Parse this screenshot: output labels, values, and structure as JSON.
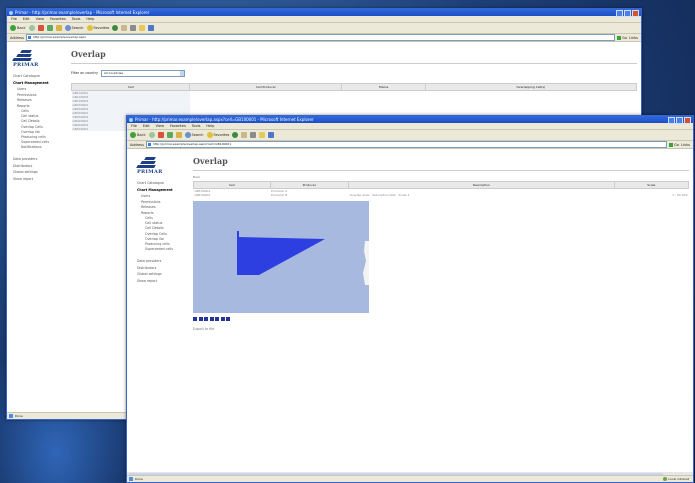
{
  "colors": {
    "desktop": "#1d3f78",
    "titlebar": "#1d4fc4",
    "map_background": "#a7b9df",
    "map_polygon": "#2d3fe0",
    "brand": "#1e3f85"
  },
  "back_window": {
    "title": "Primar - http://primar.example/overlap - Microsoft Internet Explorer",
    "menu": [
      "File",
      "Edit",
      "View",
      "Favorites",
      "Tools",
      "Help"
    ],
    "toolbar": {
      "back": "Back",
      "search": "Search",
      "favorites": "Favorites"
    },
    "address": {
      "label": "Address",
      "url": "http://primar.example/overlap.aspx",
      "go": "Go",
      "links": "Links"
    },
    "logo": "PRIMAR",
    "sidebar": {
      "items": [
        "Chart Catalogue",
        "Chart Management"
      ],
      "sub": [
        "Users",
        "Permissions",
        "Releases",
        "Reports"
      ],
      "sub2": [
        "Cells",
        "Cell status",
        "Cell Details",
        "Overlap Cells",
        "Overlap list",
        "Producing cells",
        "Superseded cells",
        "Notifications"
      ],
      "bottom": [
        "Data providers",
        "Distributors",
        "Global settings",
        "Show report"
      ]
    },
    "page_title": "Overlap",
    "filter_label": "Filter on country",
    "filter_value": "All Countries",
    "table_headers": [
      "Cell",
      "Cell Producer",
      "Status",
      "Overlapping Cell(s)"
    ],
    "rows": [
      "GB100001",
      "GB100002",
      "GB100003",
      "GB200001",
      "GB200002",
      "GB300001",
      "GB300002",
      "GB400001",
      "GB400002",
      "GB500001"
    ],
    "status": "Done",
    "zone": "Local intranet"
  },
  "front_window": {
    "title": "Primar - http://primar.example/overlap.aspx?cell=GB100001 - Microsoft Internet Explorer",
    "menu": [
      "File",
      "Edit",
      "View",
      "Favorites",
      "Tools",
      "Help"
    ],
    "toolbar": {
      "back": "Back",
      "search": "Search",
      "favorites": "Favorites"
    },
    "address": {
      "label": "Address",
      "url": "http://primar.example/overlap.aspx?cell=GB100001",
      "go": "Go",
      "links": "Links"
    },
    "logo": "PRIMAR",
    "sidebar": {
      "items": [
        "Chart Catalogue",
        "Chart Management"
      ],
      "sub": [
        "Users",
        "Permissions",
        "Releases",
        "Reports"
      ],
      "sub2": [
        "Cells",
        "Cell status",
        "Cell Details",
        "Overlap Cells",
        "Overlap list",
        "Producing cells",
        "Superseded cells"
      ],
      "bottom": [
        "Data providers",
        "Distributors",
        "Global settings",
        "Show report"
      ]
    },
    "page_title": "Overlap",
    "back_link": "Back",
    "table_headers": [
      "Cell",
      "Producer",
      "Description",
      "Scale"
    ],
    "rows": [
      [
        "GB100001",
        "Producer A",
        "",
        ""
      ],
      [
        "GB100002",
        "Producer B",
        "Overlap area - description text - Scale 1",
        "1 : 50 000"
      ]
    ],
    "export_link": "Export to file",
    "status": "Done",
    "zone": "Local intranet"
  }
}
